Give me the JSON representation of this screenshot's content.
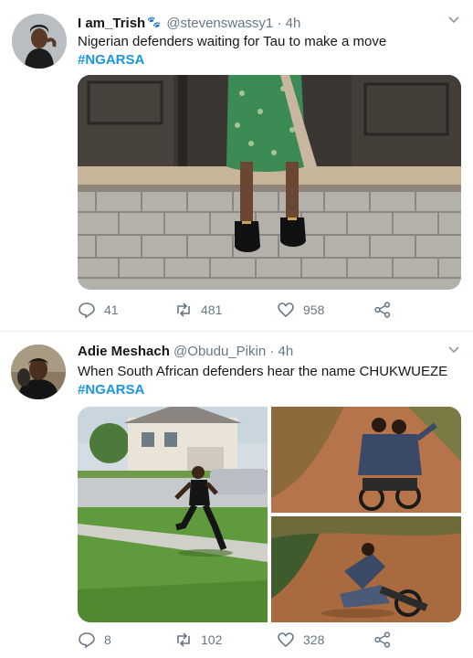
{
  "tweets": [
    {
      "display_name": "I am_Trish",
      "handle": "@stevenswassy1",
      "separator": "·",
      "time": "4h",
      "text": "Nigerian defenders waiting for Tau to make a move",
      "hashtag": "#NGARSA",
      "replies": "41",
      "retweets": "481",
      "likes": "958"
    },
    {
      "display_name": "Adie Meshach",
      "handle": "@Obudu_Pikin",
      "separator": "·",
      "time": "4h",
      "text": "When South African defenders hear the name CHUKWUEZE",
      "hashtag": "#NGARSA",
      "replies": "8",
      "retweets": "102",
      "likes": "328"
    }
  ],
  "colors": {
    "text": "#14171a",
    "secondary": "#657786",
    "hashtag": "#1b95e0",
    "divider": "#e6ecf0"
  },
  "icons": [
    "reply-icon",
    "retweet-icon",
    "like-icon",
    "share-icon",
    "chevron-down-icon"
  ]
}
